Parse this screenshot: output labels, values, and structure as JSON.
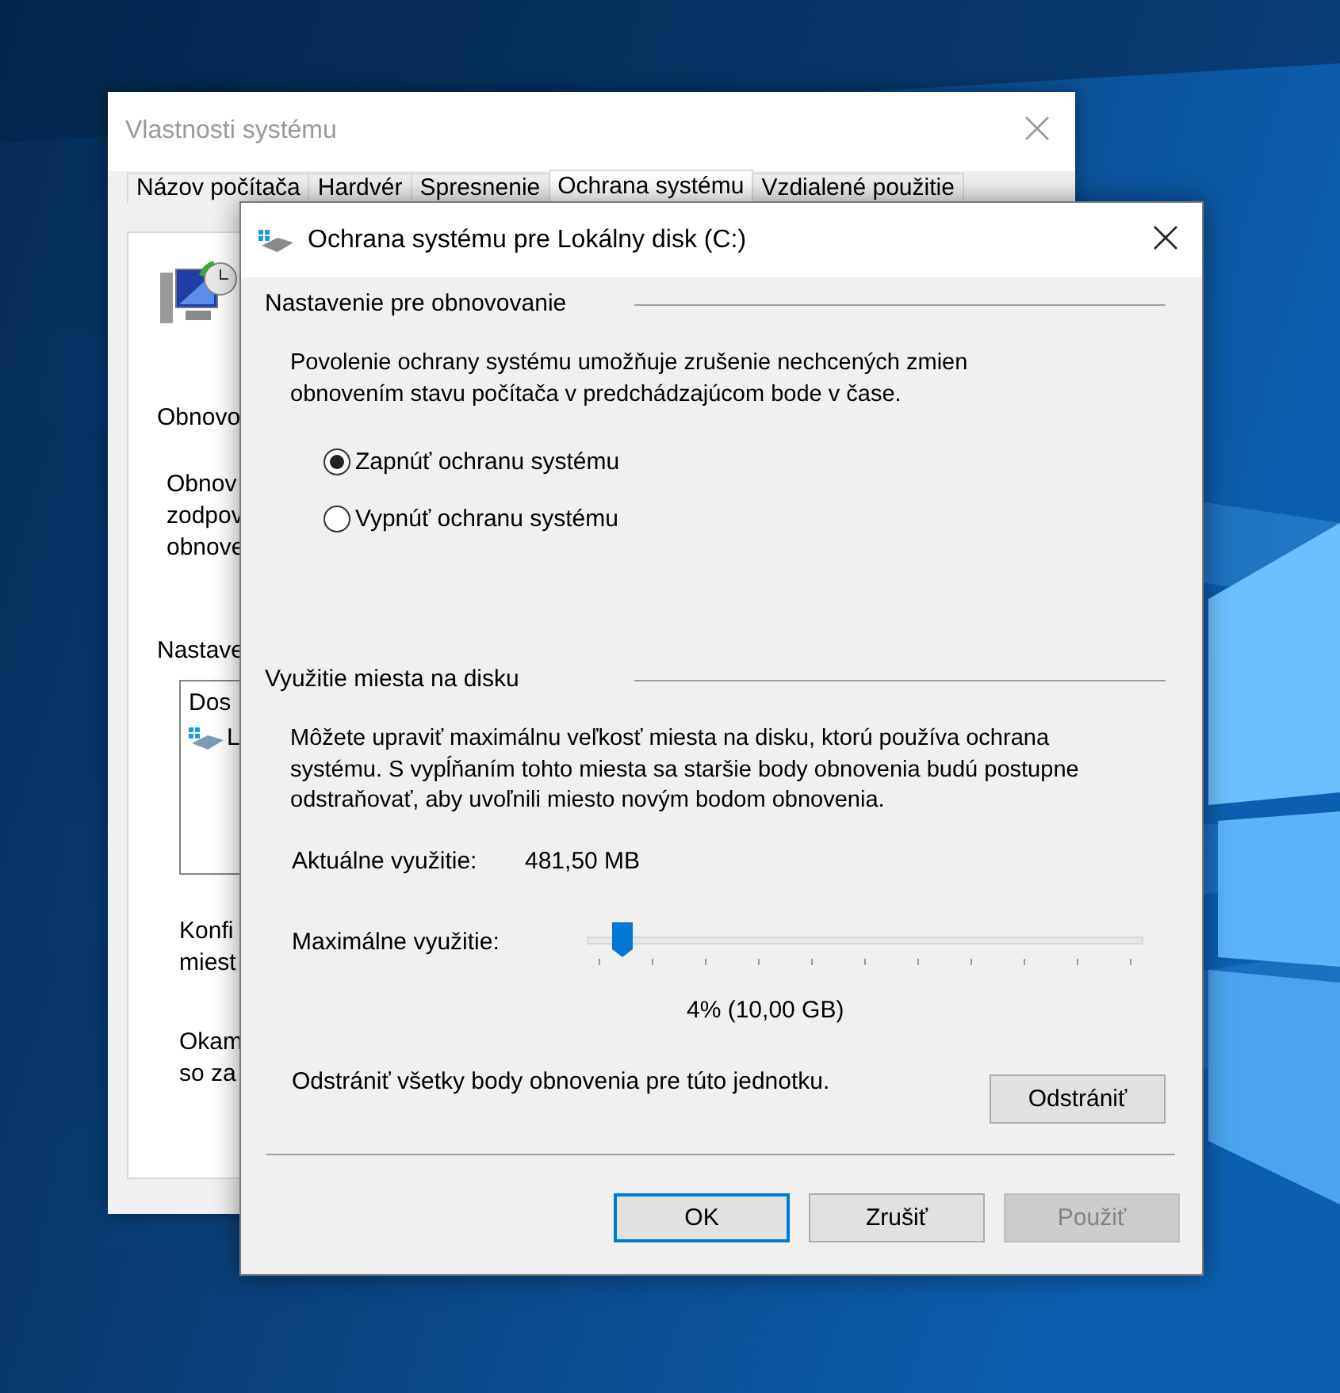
{
  "back_window": {
    "title": "Vlastnosti systému",
    "tabs": [
      {
        "label": "Názov počítača",
        "selected": false
      },
      {
        "label": "Hardvér",
        "selected": false
      },
      {
        "label": "Spresnenie",
        "selected": false
      },
      {
        "label": "Ochrana systému",
        "selected": true
      },
      {
        "label": "Vzdialené použitie",
        "selected": false
      }
    ],
    "section_1": "Obnovo",
    "paragraph_1": [
      "Obnov",
      "zodpov",
      "obnove"
    ],
    "section_2": "Nastave",
    "drive_list": {
      "header": "Dos",
      "item": "L"
    },
    "paragraph_2": [
      "Konfi",
      "miest"
    ],
    "paragraph_3": [
      "Okam",
      "so za"
    ]
  },
  "dialog": {
    "title": "Ochrana systému pre Lokálny disk (C:)",
    "restore_heading": "Nastavenie pre obnovovanie",
    "restore_description": [
      "Povolenie ochrany systému umožňuje zrušenie nechcených zmien",
      "obnovením stavu počítača v predchádzajúcom bode v čase."
    ],
    "radios": [
      {
        "label": "Zapnúť ochranu systému",
        "selected": true
      },
      {
        "label": "Vypnúť ochranu systému",
        "selected": false
      }
    ],
    "disk_heading": "Využitie miesta na disku",
    "disk_description": [
      "Môžete upraviť maximálnu veľkosť miesta na disku, ktorú používa ochrana",
      "systému. S vypĺňaním tohto miesta sa staršie body obnovenia budú postupne",
      "odstraňovať, aby uvoľnili miesto novým bodom obnovenia."
    ],
    "current_usage": {
      "label": "Aktuálne využitie:",
      "value": "481,50 MB"
    },
    "max_usage": {
      "label": "Maximálne využitie:",
      "level": 0.04,
      "reading": "4% (10,00 GB)"
    },
    "delete_text": "Odstrániť všetky body obnovenia pre túto jednotku.",
    "delete_button": "Odstrániť",
    "buttons": [
      {
        "label": "OK",
        "focused": true,
        "disabled": false
      },
      {
        "label": "Zrušiť",
        "focused": false,
        "disabled": false
      },
      {
        "label": "Použiť",
        "focused": false,
        "disabled": true
      }
    ]
  }
}
